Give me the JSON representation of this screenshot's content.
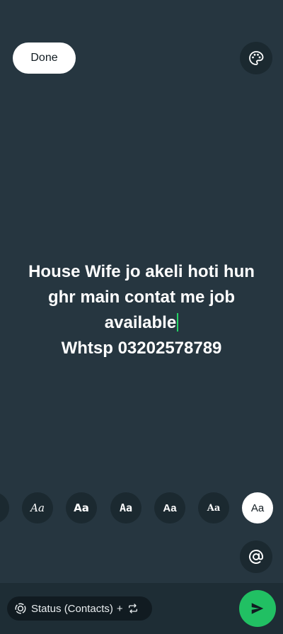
{
  "toolbar": {
    "done_label": "Done",
    "palette_icon": "palette-icon"
  },
  "status": {
    "lines": [
      "House Wife jo akeli hoti hun",
      "ghr main contat me job",
      "available",
      "Whtsp 03202578789"
    ],
    "caret_color": "#25d366",
    "background_color": "#263640"
  },
  "font_picker": {
    "options": [
      "Aa",
      "Aa",
      "Aa",
      "Aa",
      "Aa",
      "Aa",
      "Aa"
    ],
    "selected_index": 6
  },
  "mention": {
    "icon": "at-sign-icon"
  },
  "bottom_bar": {
    "audience_label": "Status (Contacts)",
    "plus": "+",
    "status_icon": "status-ring-icon",
    "repeat_icon": "repeat-icon",
    "send_icon": "send-icon",
    "send_color": "#21c063"
  }
}
